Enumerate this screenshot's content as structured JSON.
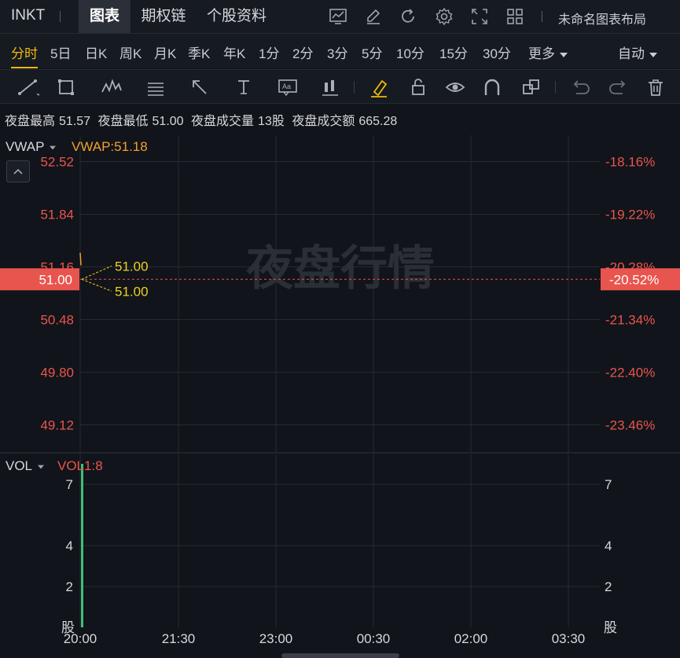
{
  "header": {
    "symbol": "INKT",
    "tabs": [
      {
        "label": "图表",
        "active": true
      },
      {
        "label": "期权链",
        "active": false
      },
      {
        "label": "个股资料",
        "active": false
      }
    ],
    "icons": [
      "chart-settings-icon",
      "edit-icon",
      "refresh-icon",
      "settings-icon",
      "fullscreen-icon",
      "grid-layout-icon"
    ],
    "layout_name": "未命名图表布局"
  },
  "periods": {
    "items": [
      "分时",
      "5日",
      "日K",
      "周K",
      "月K",
      "季K",
      "年K",
      "1分",
      "2分",
      "3分",
      "5分",
      "10分",
      "15分",
      "30分",
      "更多"
    ],
    "active": "分时",
    "scale_mode": "自动"
  },
  "draw_tools": [
    "trendline-icon",
    "rectangle-icon",
    "wave-icon",
    "fib-icon",
    "arrow-icon",
    "text-icon",
    "note-icon",
    "candle-icon",
    "highlighter-icon",
    "lock-icon",
    "eye-icon",
    "magnet-icon",
    "layers-icon",
    "undo-icon",
    "redo-icon",
    "trash-icon"
  ],
  "stats": {
    "night_high_label": "夜盘最高",
    "night_high": "51.57",
    "night_low_label": "夜盘最低",
    "night_low": "51.00",
    "night_volume_label": "夜盘成交量",
    "night_volume": "13股",
    "night_amount_label": "夜盘成交额",
    "night_amount": "665.28"
  },
  "main_panel": {
    "indicator": "VWAP",
    "indicator_value": "VWAP:51.18",
    "watermark": "夜盘行情",
    "price_ticks": [
      "52.52",
      "51.84",
      "51.16",
      "50.48",
      "49.80",
      "49.12"
    ],
    "pct_ticks": [
      "-18.16%",
      "-19.22%",
      "-20.28%",
      "-21.34%",
      "-22.40%",
      "-23.46%"
    ],
    "current_price": "51.00",
    "current_pct": "-20.52%",
    "annotation_high": "51.00",
    "annotation_low": "51.00",
    "colors": {
      "price": "#e8554e",
      "vwap": "#f0a030",
      "annotation": "#f0d020"
    }
  },
  "volume_panel": {
    "indicator": "VOL",
    "indicator_value": "VOL1:8",
    "ticks": [
      "7",
      "4",
      "2"
    ],
    "unit": "股",
    "colors": {
      "bar": "#3fbf78"
    }
  },
  "time_axis": [
    "20:00",
    "21:30",
    "23:00",
    "00:30",
    "02:00",
    "03:30"
  ],
  "chart_data": {
    "type": "line",
    "price_ylim": [
      48.76,
      52.86
    ],
    "price_points": [
      {
        "t": "20:00",
        "price": 51.0
      }
    ],
    "vwap": 51.18,
    "volume": [
      {
        "t": "20:00",
        "value": 8
      }
    ],
    "vol_ylim": [
      0,
      8
    ]
  }
}
